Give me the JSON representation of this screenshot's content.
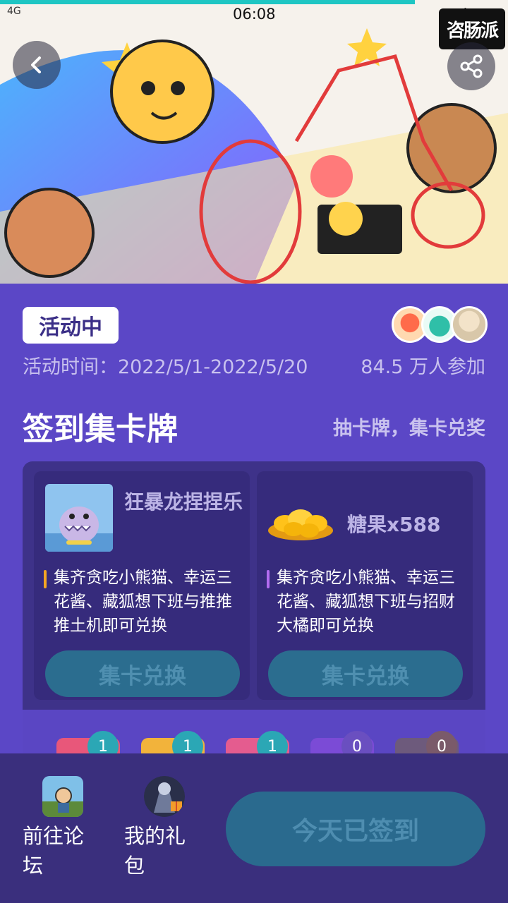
{
  "status_bar": {
    "time": "06:08",
    "network": "4G"
  },
  "hero": {
    "logo_text": "咨肠派"
  },
  "activity": {
    "status_tag": "活动中",
    "time_label": "活动时间：2022/5/1-2022/5/20",
    "participants": "84.5 万人参加"
  },
  "section": {
    "title": "签到集卡牌",
    "subtitle": "抽卡牌，集卡兑奖"
  },
  "rewards": [
    {
      "name": "狂暴龙捏捏乐",
      "desc": "集齐贪吃小熊猫、幸运三花酱、藏狐想下班与推推推土机即可兑换",
      "button": "集卡兑换",
      "accent": "#f5a623"
    },
    {
      "name": "糖果x588",
      "desc": "集齐贪吃小熊猫、幸运三花酱、藏狐想下班与招财大橘即可兑换",
      "button": "集卡兑换",
      "accent": "#b36cf0"
    }
  ],
  "cards": [
    {
      "count": "1",
      "color": "#e8577a"
    },
    {
      "count": "1",
      "color": "#f2b33b"
    },
    {
      "count": "1",
      "color": "#e45c8f"
    },
    {
      "count": "0",
      "color": "#7b4bd6"
    },
    {
      "count": "0",
      "color": "#6d5a7c"
    }
  ],
  "bottom_nav": {
    "forum_label": "前往论坛",
    "gift_label": "我的礼包",
    "checkin_button": "今天已签到"
  }
}
